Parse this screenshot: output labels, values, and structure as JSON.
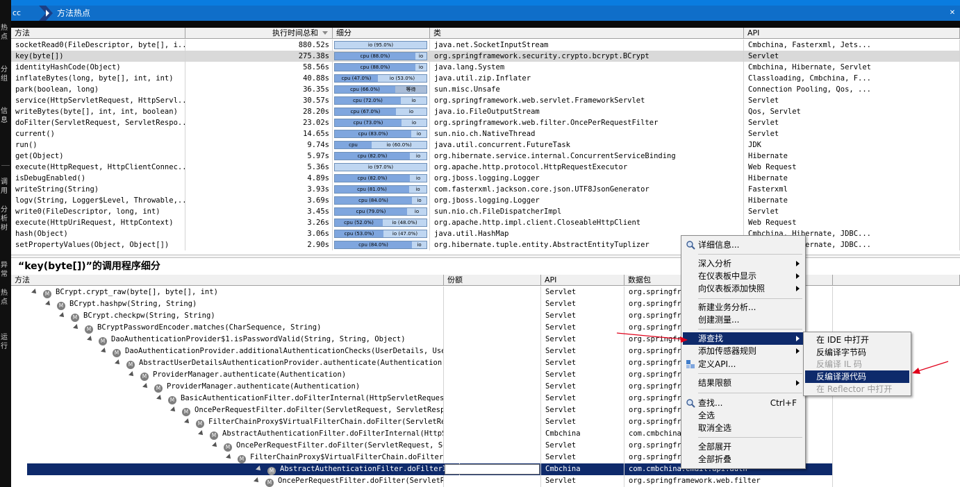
{
  "left_strip": {
    "items": [
      "热点",
      "分组",
      "信息",
      "调用",
      "分析树",
      "异常",
      "热点",
      "运行"
    ]
  },
  "header": {
    "app_name": "cc",
    "title": "方法热点"
  },
  "hotspots": {
    "columns": {
      "method": "方法",
      "time_total": "执行时间总和",
      "breakdown": "细分",
      "class": "类",
      "api": "API"
    },
    "rows": [
      {
        "method": "socketRead0(FileDescriptor, byte[], i...",
        "time": "880.52s",
        "cls": "java.net.SocketInputStream",
        "api": "Cmbchina, Fasterxml, Jets...",
        "segs": [
          {
            "type": "io",
            "label": "io (95.0%)",
            "pct": 95.0
          }
        ]
      },
      {
        "method": "key(byte[])",
        "time": "275.38s",
        "cls": "org.springframework.security.crypto.bcrypt.BCrypt",
        "api": "Servlet",
        "selected": true,
        "segs": [
          {
            "type": "cpu",
            "label": "cpu (88.0%)",
            "pct": 88.0
          },
          {
            "type": "io",
            "label": "io",
            "pct": 12.0
          }
        ]
      },
      {
        "method": "identityHashCode(Object)",
        "time": "58.56s",
        "cls": "java.lang.System",
        "api": "Cmbchina, Hibernate, Servlet",
        "segs": [
          {
            "type": "cpu",
            "label": "cpu (88.0%)",
            "pct": 88.0
          },
          {
            "type": "io",
            "label": "io",
            "pct": 12.0
          }
        ]
      },
      {
        "method": "inflateBytes(long, byte[], int, int)",
        "time": "40.88s",
        "cls": "java.util.zip.Inflater",
        "api": "Classloading, Cmbchina, F...",
        "segs": [
          {
            "type": "cpu",
            "label": "cpu (47.0%)",
            "pct": 47.0
          },
          {
            "type": "io",
            "label": "io (53.0%)",
            "pct": 53.0
          }
        ]
      },
      {
        "method": "park(boolean, long)",
        "time": "36.35s",
        "cls": "sun.misc.Unsafe",
        "api": "Connection Pooling, Qos, ...",
        "segs": [
          {
            "type": "cpu",
            "label": "cpu (66.0%)",
            "pct": 66.0
          },
          {
            "type": "wait",
            "label": "等待",
            "pct": 34.0
          }
        ]
      },
      {
        "method": "service(HttpServletRequest, HttpServl...",
        "time": "30.57s",
        "cls": "org.springframework.web.servlet.FrameworkServlet",
        "api": "Servlet",
        "segs": [
          {
            "type": "cpu",
            "label": "cpu (72.0%)",
            "pct": 72.0
          },
          {
            "type": "io",
            "label": "io",
            "pct": 28.0
          }
        ]
      },
      {
        "method": "writeBytes(byte[], int, int, boolean)",
        "time": "28.20s",
        "cls": "java.io.FileOutputStream",
        "api": "Qos, Servlet",
        "segs": [
          {
            "type": "cpu",
            "label": "cpu (67.0%)",
            "pct": 67.0
          },
          {
            "type": "io",
            "label": "io",
            "pct": 33.0
          }
        ]
      },
      {
        "method": "doFilter(ServletRequest, ServletRespo...",
        "time": "23.02s",
        "cls": "org.springframework.web.filter.OncePerRequestFilter",
        "api": "Servlet",
        "segs": [
          {
            "type": "cpu",
            "label": "cpu (73.0%)",
            "pct": 73.0
          },
          {
            "type": "io",
            "label": "io",
            "pct": 27.0
          }
        ]
      },
      {
        "method": "current()",
        "time": "14.65s",
        "cls": "sun.nio.ch.NativeThread",
        "api": "Servlet",
        "segs": [
          {
            "type": "cpu",
            "label": "cpu (83.0%)",
            "pct": 83.0
          },
          {
            "type": "io",
            "label": "io",
            "pct": 17.0
          }
        ]
      },
      {
        "method": "run()",
        "time": "9.74s",
        "cls": "java.util.concurrent.FutureTask",
        "api": "JDK",
        "segs": [
          {
            "type": "cpu",
            "label": "cpu",
            "pct": 40.0
          },
          {
            "type": "io",
            "label": "io (60.0%)",
            "pct": 60.0
          }
        ]
      },
      {
        "method": "get(Object)",
        "time": "5.97s",
        "cls": "org.hibernate.service.internal.ConcurrentServiceBinding",
        "api": "Hibernate",
        "segs": [
          {
            "type": "cpu",
            "label": "cpu (82.0%)",
            "pct": 82.0
          },
          {
            "type": "io",
            "label": "io",
            "pct": 18.0
          }
        ]
      },
      {
        "method": "execute(HttpRequest, HttpClientConnec...",
        "time": "5.36s",
        "cls": "org.apache.http.protocol.HttpRequestExecutor",
        "api": "Web Request",
        "segs": [
          {
            "type": "io",
            "label": "io (97.0%)",
            "pct": 97.0
          }
        ]
      },
      {
        "method": "isDebugEnabled()",
        "time": "4.89s",
        "cls": "org.jboss.logging.Logger",
        "api": "Hibernate",
        "segs": [
          {
            "type": "cpu",
            "label": "cpu (82.0%)",
            "pct": 82.0
          },
          {
            "type": "io",
            "label": "io",
            "pct": 18.0
          }
        ]
      },
      {
        "method": "writeString(String)",
        "time": "3.93s",
        "cls": "com.fasterxml.jackson.core.json.UTF8JsonGenerator",
        "api": "Fasterxml",
        "segs": [
          {
            "type": "cpu",
            "label": "cpu (81.0%)",
            "pct": 81.0
          },
          {
            "type": "io",
            "label": "io",
            "pct": 19.0
          }
        ]
      },
      {
        "method": "logv(String, Logger$Level, Throwable,...",
        "time": "3.69s",
        "cls": "org.jboss.logging.Logger",
        "api": "Hibernate",
        "segs": [
          {
            "type": "cpu",
            "label": "cpu (84.0%)",
            "pct": 84.0
          },
          {
            "type": "io",
            "label": "io",
            "pct": 16.0
          }
        ]
      },
      {
        "method": "write0(FileDescriptor, long, int)",
        "time": "3.45s",
        "cls": "sun.nio.ch.FileDispatcherImpl",
        "api": "Servlet",
        "segs": [
          {
            "type": "cpu",
            "label": "cpu (79.0%)",
            "pct": 79.0
          },
          {
            "type": "io",
            "label": "io",
            "pct": 21.0
          }
        ]
      },
      {
        "method": "execute(HttpUriRequest, HttpContext)",
        "time": "3.26s",
        "cls": "org.apache.http.impl.client.CloseableHttpClient",
        "api": "Web Request",
        "segs": [
          {
            "type": "cpu",
            "label": "cpu (52.0%)",
            "pct": 52.0
          },
          {
            "type": "io",
            "label": "io (48.0%)",
            "pct": 48.0
          }
        ]
      },
      {
        "method": "hash(Object)",
        "time": "3.06s",
        "cls": "java.util.HashMap",
        "api": "Cmbchina, Hibernate, JDBC...",
        "segs": [
          {
            "type": "cpu",
            "label": "cpu (53.0%)",
            "pct": 53.0
          },
          {
            "type": "io",
            "label": "io (47.0%)",
            "pct": 47.0
          }
        ]
      },
      {
        "method": "setPropertyValues(Object, Object[])",
        "time": "2.90s",
        "cls": "org.hibernate.tuple.entity.AbstractEntityTuplizer",
        "api": "Cmbchina, Hibernate, JDBC...",
        "segs": [
          {
            "type": "cpu",
            "label": "cpu (84.0%)",
            "pct": 84.0
          },
          {
            "type": "io",
            "label": "io",
            "pct": 16.0
          }
        ]
      }
    ]
  },
  "callers": {
    "title": "“key(byte[])”的调用程序细分",
    "columns": {
      "method": "方法",
      "share": "份额",
      "api": "API",
      "package": "数据包"
    },
    "rows": [
      {
        "method": "BCrypt.crypt_raw(byte[], byte[], int)",
        "api": "Servlet",
        "pkg": "org.springfra",
        "depth": 0
      },
      {
        "method": "BCrypt.hashpw(String, String)",
        "api": "Servlet",
        "pkg": "org.springfra",
        "depth": 1
      },
      {
        "method": "BCrypt.checkpw(String, String)",
        "api": "Servlet",
        "pkg": "org.springfra",
        "depth": 2
      },
      {
        "method": "BCryptPasswordEncoder.matches(CharSequence, String)",
        "api": "Servlet",
        "pkg": "org.springfra",
        "depth": 3
      },
      {
        "method": "DaoAuthenticationProvider$1.isPasswordValid(String, String, Object)",
        "api": "Servlet",
        "pkg": "org.springfra",
        "depth": 4
      },
      {
        "method": "DaoAuthenticationProvider.additionalAuthenticationChecks(UserDetails, Userna",
        "api": "Servlet",
        "pkg": "org.springfra",
        "depth": 5
      },
      {
        "method": "AbstractUserDetailsAuthenticationProvider.authenticate(Authentication)",
        "api": "Servlet",
        "pkg": "org.springfra",
        "depth": 6
      },
      {
        "method": "ProviderManager.authenticate(Authentication)",
        "api": "Servlet",
        "pkg": "org.springfra",
        "depth": 7
      },
      {
        "method": "ProviderManager.authenticate(Authentication)",
        "api": "Servlet",
        "pkg": "org.springfra",
        "depth": 8
      },
      {
        "method": "BasicAuthenticationFilter.doFilterInternal(HttpServletRequest,",
        "api": "Servlet",
        "pkg": "org.springfra",
        "depth": 9
      },
      {
        "method": "OncePerRequestFilter.doFilter(ServletRequest, ServletRespon",
        "api": "Servlet",
        "pkg": "org.springfra",
        "depth": 10
      },
      {
        "method": "FilterChainProxy$VirtualFilterChain.doFilter(ServletReque",
        "api": "Servlet",
        "pkg": "org.springfra",
        "depth": 11
      },
      {
        "method": "AbstractAuthenticationFilter.doFilterInternal(HttpSe",
        "api": "Cmbchina",
        "pkg": "com.cmbchina.",
        "depth": 12
      },
      {
        "method": "OncePerRequestFilter.doFilter(ServletRequest, Ser",
        "api": "Servlet",
        "pkg": "org.springfra",
        "depth": 13
      },
      {
        "method": "FilterChainProxy$VirtualFilterChain.doFilter(S",
        "api": "Servlet",
        "pkg": "org.springfra",
        "depth": 14
      },
      {
        "method": "AbstractAuthenticationFilter.doFilterInter",
        "api": "Cmbchina",
        "pkg": "com.cmbchina.email.api.auth",
        "depth": 15,
        "selected": true
      },
      {
        "method": "OncePerRequestFilter.doFilter(ServletRe",
        "api": "Servlet",
        "pkg": "org.springframework.web.filter",
        "depth": 16
      }
    ]
  },
  "context_menu": {
    "items": {
      "details": "详细信息...",
      "drill_down": "深入分析",
      "show_in_dashboard": "在仪表板中显示",
      "add_to_dashboard": "向仪表板添加快照",
      "new_business": "新建业务分析...",
      "create_measure": "创建测量...",
      "source_lookup": "源查找",
      "add_sensor": "添加传感器规则",
      "define_api": "定义API...",
      "result_limit": "结果限额",
      "find": "查找...",
      "find_shortcut": "Ctrl+F",
      "select_all": "全选",
      "deselect_all": "取消全选",
      "expand_all": "全部展开",
      "collapse_all": "全部折叠"
    },
    "submenu": {
      "open_ide": "在 IDE 中打开",
      "decompile_bytecode": "反编译字节码",
      "decompile_il": "反编译 IL 码",
      "decompile_source": "反编译源代码",
      "open_reflector": "在 Reflector 中打开"
    }
  },
  "colors": {
    "title_bar": "#0f6ec9",
    "selection": "#0e2a6b",
    "cpu": "#7fa6de",
    "io": "#bfd6f1",
    "annotation": "#e0001a"
  }
}
